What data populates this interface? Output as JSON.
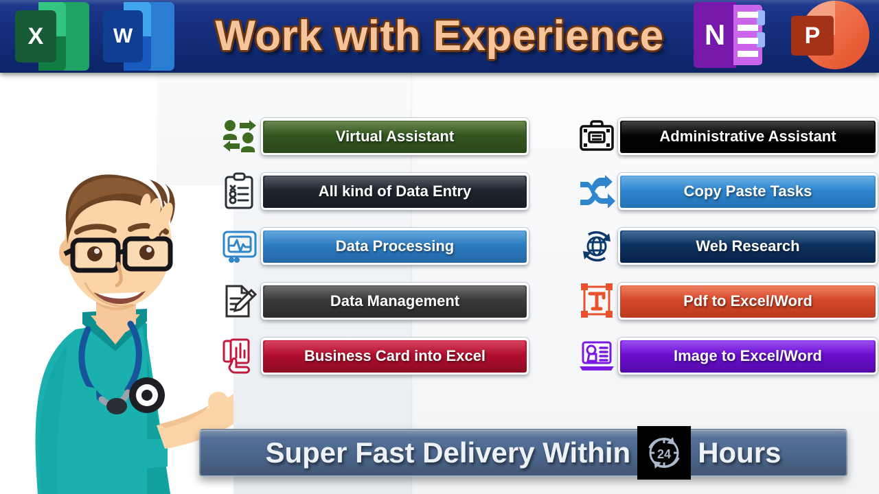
{
  "header": {
    "title": "Work with Experience",
    "brand_color": "#f6c49a",
    "bar_color": "#16307e",
    "logos": [
      {
        "name": "excel-logo",
        "letter": "X",
        "color": "#21a366"
      },
      {
        "name": "word-logo",
        "letter": "W",
        "color": "#2b7cd3"
      },
      {
        "name": "onenote-logo",
        "letter": "N",
        "color": "#7719aa"
      },
      {
        "name": "powerpoint-logo",
        "letter": "P",
        "color": "#ed6c47"
      }
    ]
  },
  "services": {
    "left_column": [
      {
        "label": "Virtual Assistant",
        "icon": "users-exchange-icon",
        "color": "#33571f",
        "icon_color": "#3d6b22"
      },
      {
        "label": "All kind of Data Entry",
        "icon": "clipboard-checklist-icon",
        "color": "#20262f",
        "icon_color": "#2a2f38"
      },
      {
        "label": "Data Processing",
        "icon": "monitor-pulse-icon",
        "color": "#2d7cc1",
        "icon_color": "#2f86c9"
      },
      {
        "label": "Data Management",
        "icon": "document-pencil-icon",
        "color": "#3a3a3a",
        "icon_color": "#2e2e2e"
      },
      {
        "label": "Business Card into Excel",
        "icon": "card-hand-icon",
        "color": "#b20f2e",
        "icon_color": "#c2183c"
      }
    ],
    "right_column": [
      {
        "label": "Administrative Assistant",
        "icon": "briefcase-icon",
        "color": "#040404",
        "icon_color": "#0d0d0d"
      },
      {
        "label": "Copy Paste Tasks",
        "icon": "shuffle-arrows-icon",
        "color": "#2f86cf",
        "icon_color": "#2f86cf"
      },
      {
        "label": "Web Research",
        "icon": "globe-refresh-icon",
        "color": "#0d3260",
        "icon_color": "#0d3a6b"
      },
      {
        "label": "Pdf to Excel/Word",
        "icon": "text-frame-icon",
        "color": "#d7482a",
        "icon_color": "#e8522d"
      },
      {
        "label": "Image to Excel/Word",
        "icon": "laptop-image-icon",
        "color": "#6b0fd0",
        "icon_color": "#7a1ae0"
      }
    ]
  },
  "footer": {
    "text_before": "Super Fast Delivery Within",
    "badge": "24",
    "badge_icon": "24-hours-icon",
    "text_after": "Hours",
    "bar_color": "#4e6a90"
  }
}
